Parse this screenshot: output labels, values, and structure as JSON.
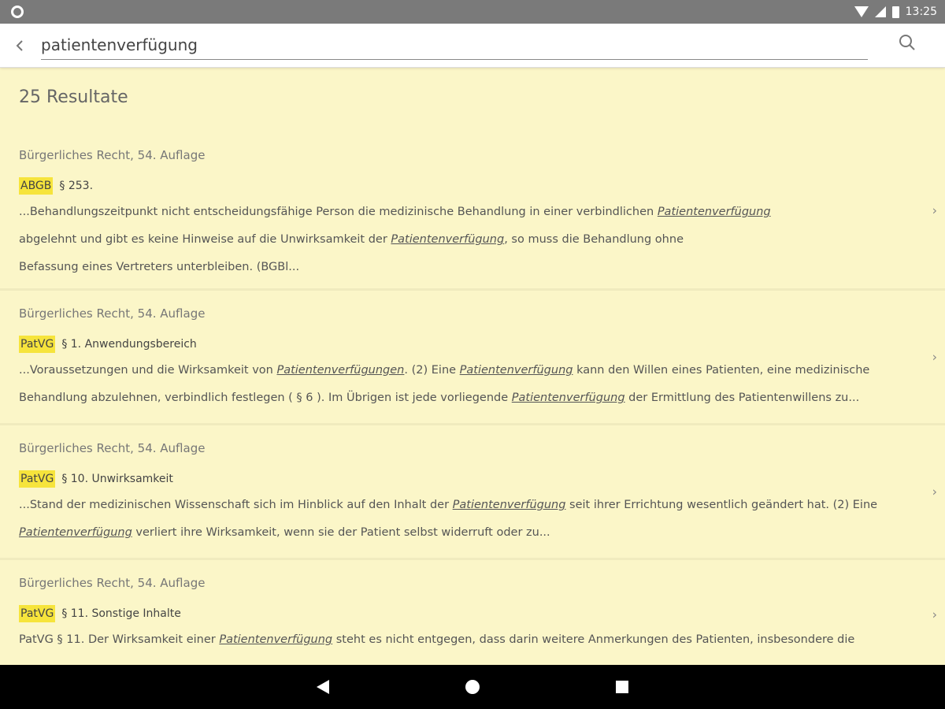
{
  "status_bar": {
    "time": "13:25",
    "left_icon": "circle-icon",
    "icons": [
      "wifi-icon",
      "signal-icon",
      "battery-icon"
    ]
  },
  "search": {
    "query": "patientenverfügung",
    "back_icon": "chevron-left-icon",
    "search_icon": "search-icon"
  },
  "results": {
    "count_label": "25 Resultate",
    "items": [
      {
        "source": "Bürgerliches Recht, 54. Auflage",
        "tag": "ABGB",
        "section": "§ 253.",
        "lines": [
          [
            "...Behandlungszeitpunkt nicht entscheidungsfähige Person die medizinische Behandlung in einer verbindlichen ",
            "Patientenverfügung",
            ""
          ],
          [
            "abgelehnt und gibt es keine Hinweise auf die Unwirksamkeit der ",
            "Patientenverfügung",
            ", so muss die Behandlung ohne"
          ],
          [
            "Befassung eines Vertreters unterbleiben. (BGBl...",
            "",
            ""
          ]
        ]
      },
      {
        "source": "Bürgerliches Recht, 54. Auflage",
        "tag": "PatVG",
        "section": "§ 1. Anwendungsbereich",
        "lines": [
          [
            "...Voraussetzungen und die Wirksamkeit von ",
            "Patientenverfügungen",
            ". (2) Eine ",
            "Patientenverfügung",
            " kann den Willen eines Patienten, eine medizinische"
          ],
          [
            "Behandlung abzulehnen, verbindlich festlegen ( § 6 ). Im Übrigen ist jede vorliegende ",
            "Patientenverfügung",
            " der Ermittlung des Patientenwillens zu..."
          ]
        ]
      },
      {
        "source": "Bürgerliches Recht, 54. Auflage",
        "tag": "PatVG",
        "section": "§ 10. Unwirksamkeit",
        "lines": [
          [
            "...Stand der medizinischen Wissenschaft sich im Hinblick auf den Inhalt der ",
            "Patientenverfügung",
            " seit ihrer Errichtung wesentlich geändert hat. (2) Eine"
          ],
          [
            "",
            "Patientenverfügung",
            " verliert ihre Wirksamkeit, wenn sie der Patient selbst widerruft oder zu..."
          ]
        ]
      },
      {
        "source": "Bürgerliches Recht, 54. Auflage",
        "tag": "PatVG",
        "section": "§ 11. Sonstige Inhalte",
        "lines": [
          [
            " PatVG § 11. Der Wirksamkeit einer ",
            "Patientenverfügung",
            " steht es nicht entgegen, dass darin weitere Anmerkungen des Patienten, insbesondere die"
          ]
        ]
      }
    ]
  },
  "nav_bar": {
    "back_icon": "triangle-back-icon",
    "home_icon": "circle-home-icon",
    "recents_icon": "square-recents-icon"
  },
  "colors": {
    "background": "#fbf6c8",
    "highlight": "#f6e43c",
    "status_bar": "#7a7a7a",
    "nav_bar": "#000000"
  }
}
